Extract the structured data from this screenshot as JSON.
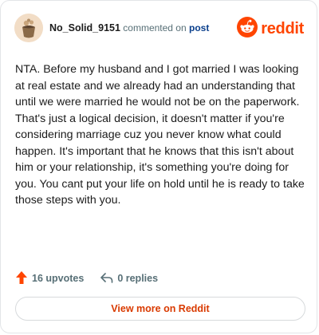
{
  "colors": {
    "brand": "#ff4500",
    "link": "#0a3f8c",
    "muted": "#576f76",
    "text": "#1c1c1c",
    "button_text": "#d93a00",
    "border": "#e3e5e8"
  },
  "header": {
    "avatar_icon": "user-avatar-icon",
    "username": "No_Solid_9151",
    "action_text": " commented on ",
    "target_link": "post",
    "brand_icon": "reddit-snoo-icon",
    "brand_name": "reddit"
  },
  "comment": {
    "body": "NTA. Before my husband and I got married I was looking at real estate and we already had an understanding that until we were married he would not be on the paperwork. That's just a logical decision, it doesn't matter if you're considering marriage cuz you never know what could happen. It's important that he knows that this isn't about him or your relationship, it's something you're doing for you. You cant put your life on hold until he is ready to take those steps with you."
  },
  "actions": {
    "upvote_icon": "upvote-arrow-icon",
    "upvotes": "16 upvotes",
    "reply_icon": "reply-arrow-icon",
    "replies": "0 replies"
  },
  "footer": {
    "button_label": "View more on Reddit"
  }
}
